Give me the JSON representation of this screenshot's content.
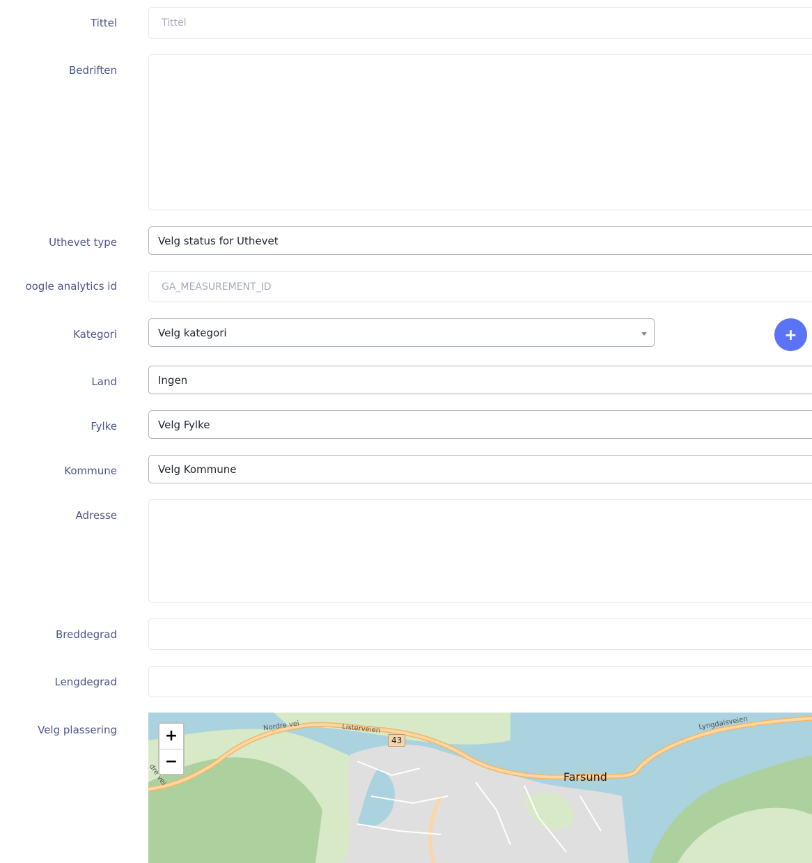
{
  "form": {
    "title": {
      "label": "Tittel",
      "placeholder": "Tittel"
    },
    "company": {
      "label": "Bedriften"
    },
    "highlight_type": {
      "label": "Uthevet type",
      "value": "Velg status for Uthevet"
    },
    "analytics": {
      "label": "oogle analytics id",
      "placeholder": "GA_MEASUREMENT_ID"
    },
    "category": {
      "label": "Kategori",
      "value": "Velg kategori",
      "add_button": "+"
    },
    "country": {
      "label": "Land",
      "value": "Ingen"
    },
    "county": {
      "label": "Fylke",
      "value": "Velg Fylke"
    },
    "municipality": {
      "label": "Kommune",
      "value": "Velg Kommune"
    },
    "address": {
      "label": "Adresse"
    },
    "latitude": {
      "label": "Breddegrad"
    },
    "longitude": {
      "label": "Lengdegrad"
    },
    "location": {
      "label": "Velg plassering"
    }
  },
  "map": {
    "zoom_in": "+",
    "zoom_out": "−",
    "place_labels": {
      "city": "Farsund",
      "road_number": "43",
      "road1": "Nordre vei",
      "road2": "Listerveien",
      "road3": "Lyngdalsveien",
      "road4": "dre vei"
    },
    "colors": {
      "water": "#aad3df",
      "land": "#d8e9c8",
      "forest": "#add19e",
      "road": "#f7c98b",
      "urban": "#e0dfdf"
    }
  }
}
